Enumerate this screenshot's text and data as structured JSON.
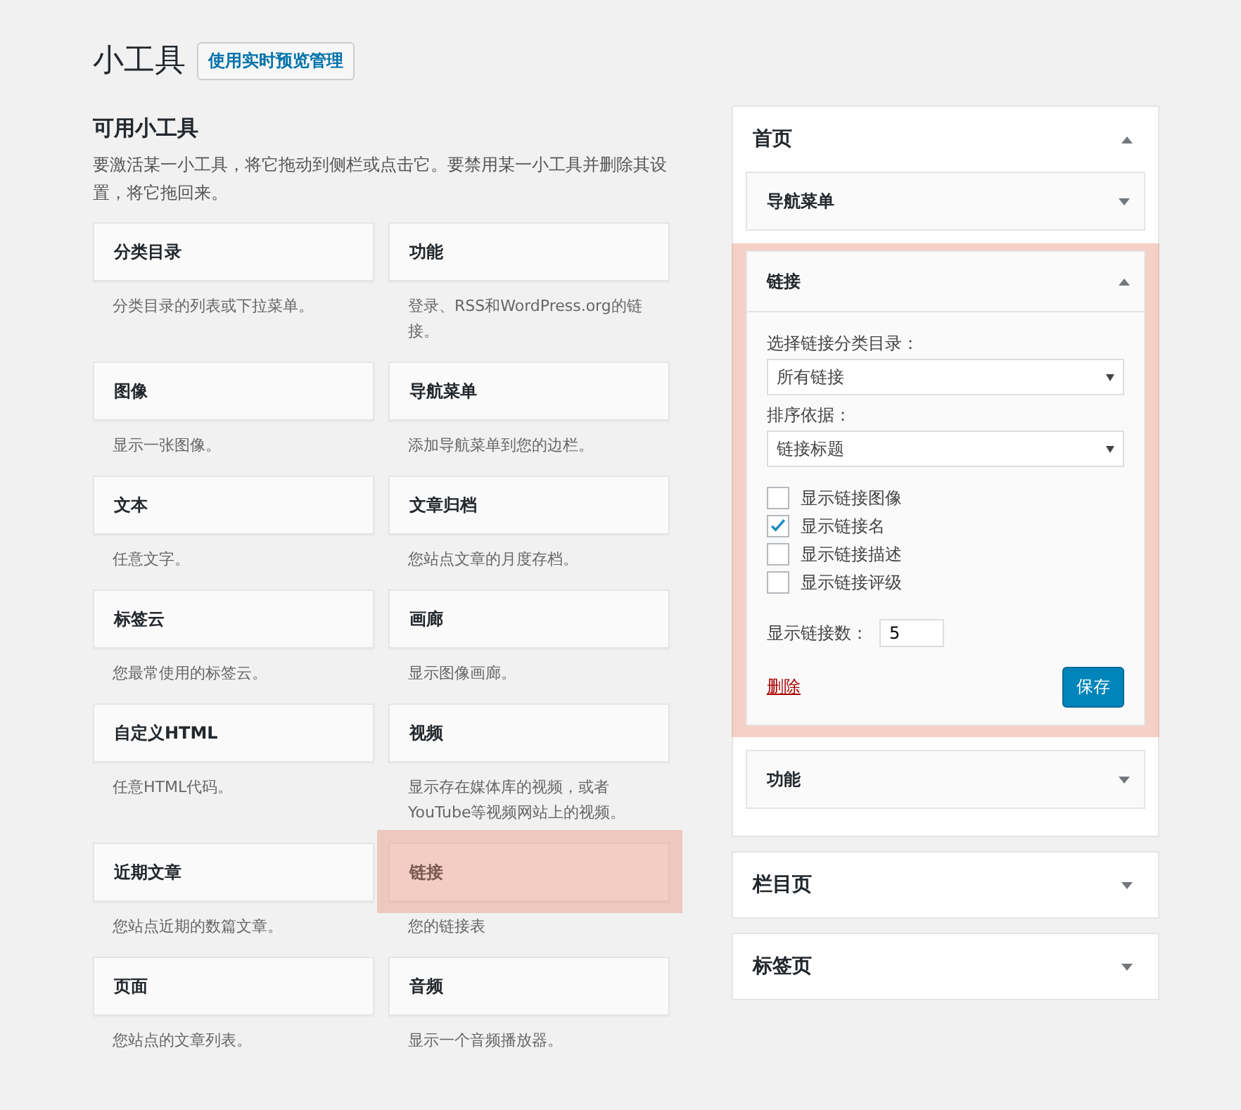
{
  "title": "小工具",
  "manage_button": "使用实时预览管理",
  "available": {
    "heading": "可用小工具",
    "description": "要激活某一小工具，将它拖动到侧栏或点击它。要禁用某一小工具并删除其设置，将它拖回来。",
    "widgets": [
      {
        "title": "分类目录",
        "description": "分类目录的列表或下拉菜单。",
        "highlighted": false
      },
      {
        "title": "功能",
        "description": "登录、RSS和WordPress.org的链接。",
        "highlighted": false
      },
      {
        "title": "图像",
        "description": "显示一张图像。",
        "highlighted": false
      },
      {
        "title": "导航菜单",
        "description": "添加导航菜单到您的边栏。",
        "highlighted": false
      },
      {
        "title": "文本",
        "description": "任意文字。",
        "highlighted": false
      },
      {
        "title": "文章归档",
        "description": "您站点文章的月度存档。",
        "highlighted": false
      },
      {
        "title": "标签云",
        "description": "您最常使用的标签云。",
        "highlighted": false
      },
      {
        "title": "画廊",
        "description": "显示图像画廊。",
        "highlighted": false
      },
      {
        "title": "自定义HTML",
        "description": "任意HTML代码。",
        "highlighted": false
      },
      {
        "title": "视频",
        "description": "显示存在媒体库的视频，或者YouTube等视频网站上的视频。",
        "highlighted": false
      },
      {
        "title": "近期文章",
        "description": "您站点近期的数篇文章。",
        "highlighted": false
      },
      {
        "title": "链接",
        "description": "您的链接表",
        "highlighted": true
      },
      {
        "title": "页面",
        "description": "您站点的文章列表。",
        "highlighted": false
      },
      {
        "title": "音频",
        "description": "显示一个音频播放器。",
        "highlighted": false
      }
    ]
  },
  "sidebars": [
    {
      "title": "首页",
      "expanded": true,
      "widgets": [
        {
          "title": "导航菜单",
          "expanded": false,
          "highlighted": false
        },
        {
          "title": "链接",
          "expanded": true,
          "highlighted": true,
          "form": {
            "category_label": "选择链接分类目录：",
            "category_value": "所有链接",
            "order_label": "排序依据：",
            "order_value": "链接标题",
            "checkboxes": [
              {
                "label": "显示链接图像",
                "checked": false
              },
              {
                "label": "显示链接名",
                "checked": true
              },
              {
                "label": "显示链接描述",
                "checked": false
              },
              {
                "label": "显示链接评级",
                "checked": false
              }
            ],
            "count_label": "显示链接数：",
            "count_value": "5",
            "delete_link": "删除",
            "save_button": "保存"
          }
        },
        {
          "title": "功能",
          "expanded": false,
          "highlighted": false
        }
      ]
    },
    {
      "title": "栏目页",
      "expanded": false
    },
    {
      "title": "标签页",
      "expanded": false
    }
  ]
}
